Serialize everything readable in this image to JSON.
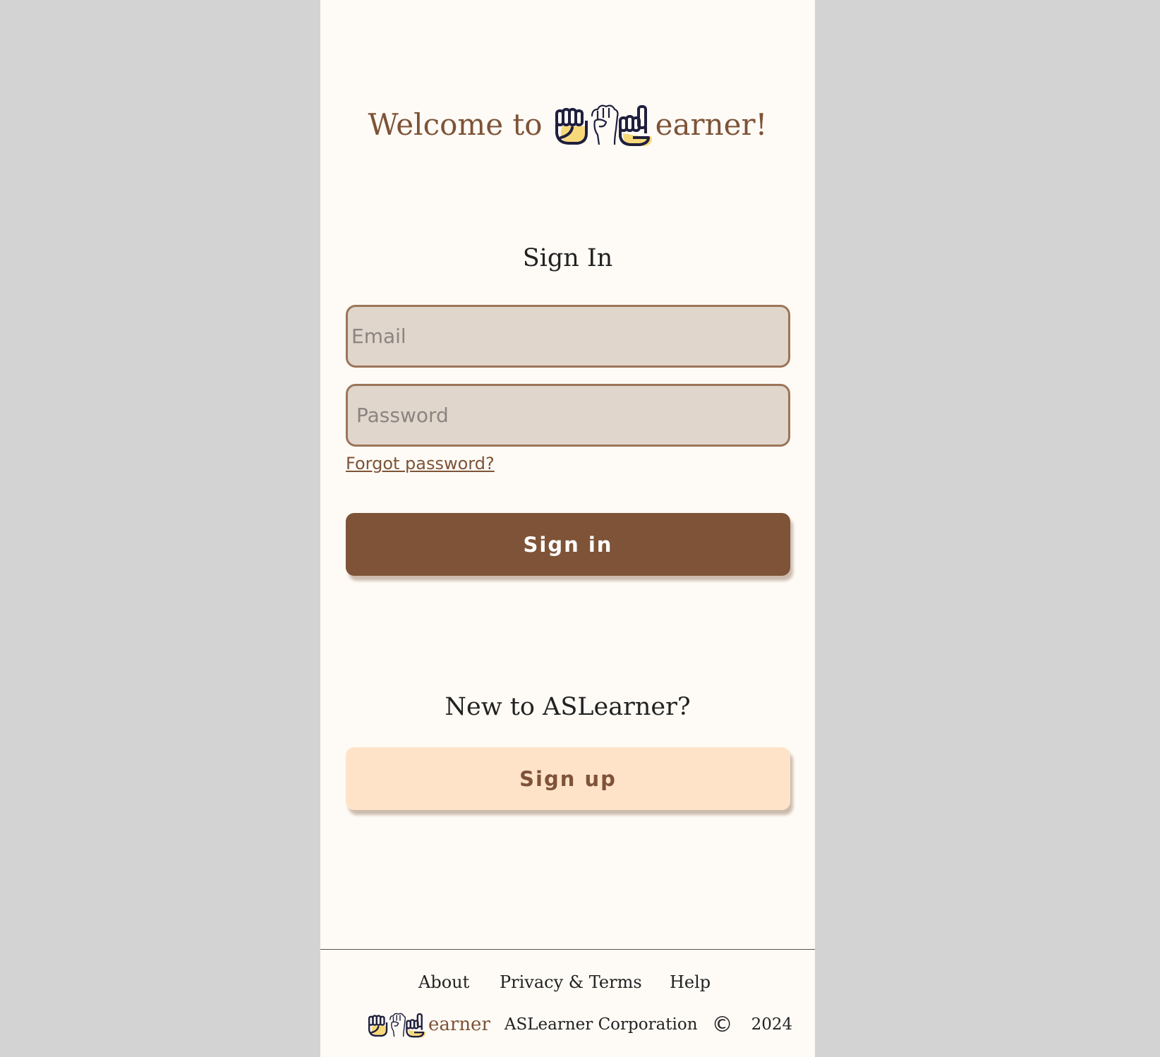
{
  "header": {
    "welcome_prefix": "Welcome to",
    "brand_suffix": "earner!",
    "logo_icon": "asl-hands-logo-icon"
  },
  "signin": {
    "title": "Sign In",
    "email_placeholder": "Email",
    "email_value": "",
    "password_placeholder": "Password",
    "password_value": "",
    "forgot_label": "Forgot password?",
    "button_label": "Sign in"
  },
  "signup": {
    "title": "New to ASLearner?",
    "button_label": "Sign up"
  },
  "footer": {
    "links": [
      "About",
      "Privacy & Terms",
      "Help"
    ],
    "brand_suffix": "earner",
    "company": "ASLearner Corporation",
    "copyright_symbol": "©",
    "year": "2024"
  },
  "colors": {
    "page_background": "#d3d3d3",
    "panel_background": "#fefbf6",
    "brand_brown": "#7e5337",
    "field_background": "#e1d6cc",
    "field_border": "#9b7558",
    "signup_background": "#ffe3c9",
    "hand_yellow": "#f8d97a",
    "hand_outline": "#1f1f3d"
  }
}
